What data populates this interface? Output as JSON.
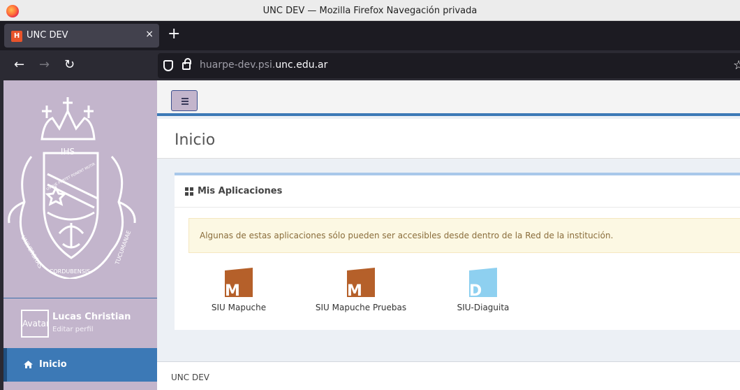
{
  "window": {
    "title": "UNC DEV — Mozilla Firefox Navegación privada"
  },
  "tab": {
    "label": "UNC DEV",
    "favicon_text": "H",
    "close_icon": "×",
    "new_tab_icon": "+"
  },
  "navbar": {
    "back_icon": "←",
    "forward_icon": "→",
    "reload_icon": "↻",
    "url_prefix": "huarpe-dev.psi.",
    "url_domain": "unc.edu.ar",
    "star_icon": "☆"
  },
  "sidebar": {
    "user": {
      "avatar_alt": "Avatar",
      "name": "Lucas Christian",
      "edit_link": "Editar perfil"
    },
    "menu": [
      {
        "label": "Inicio",
        "icon": "home-icon"
      }
    ],
    "crest": {
      "ihs": "IHS",
      "motto": "USQUE PORTET PONENT MUTIR",
      "universitas": "UNIVERSITAS",
      "cordubensis": "CORDUBENSIS",
      "tucumanae": "TUCUMANAE"
    }
  },
  "main": {
    "title": "Inicio",
    "box_title": "Mis Aplicaciones",
    "alert": "Algunas de estas aplicaciones sólo pueden ser accesibles desde dentro de la Red de la institución.",
    "apps": [
      {
        "label": "SIU Mapuche",
        "letter": "M",
        "color": "#b5602a"
      },
      {
        "label": "SIU Mapuche Pruebas",
        "letter": "M",
        "color": "#b5602a"
      },
      {
        "label": "SIU-Diaguita",
        "letter": "D",
        "color": "#8ed0f0"
      }
    ]
  },
  "footer": {
    "text": "UNC DEV"
  }
}
